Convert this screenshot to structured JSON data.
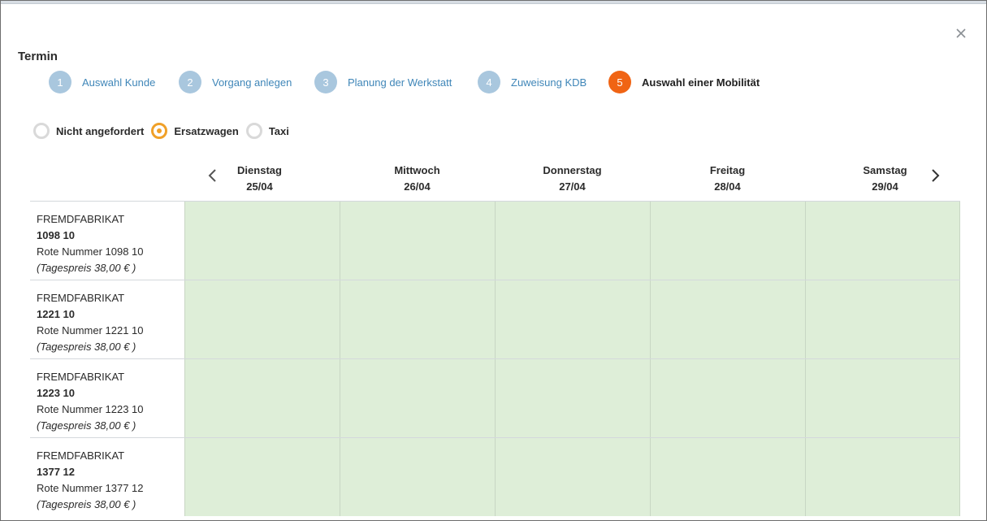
{
  "dialog": {
    "title": "Termin",
    "close_icon": "close-icon"
  },
  "steps": [
    {
      "num": "1",
      "label": "Auswahl Kunde",
      "active": false
    },
    {
      "num": "2",
      "label": "Vorgang anlegen",
      "active": false
    },
    {
      "num": "3",
      "label": "Planung der Werkstatt",
      "active": false
    },
    {
      "num": "4",
      "label": "Zuweisung KDB",
      "active": false
    },
    {
      "num": "5",
      "label": "Auswahl einer Mobilität",
      "active": true
    }
  ],
  "mobility_options": [
    {
      "label": "Nicht angefordert",
      "checked": false
    },
    {
      "label": "Ersatzwagen",
      "checked": true
    },
    {
      "label": "Taxi",
      "checked": false
    }
  ],
  "days": [
    {
      "name": "Dienstag",
      "date": "25/04"
    },
    {
      "name": "Mittwoch",
      "date": "26/04"
    },
    {
      "name": "Donnerstag",
      "date": "27/04"
    },
    {
      "name": "Freitag",
      "date": "28/04"
    },
    {
      "name": "Samstag",
      "date": "29/04"
    }
  ],
  "vehicles": [
    {
      "make": "FREMDFABRIKAT",
      "plate": "1098 10",
      "red_number": "Rote Nummer 1098 10",
      "price": "(Tagespreis 38,00 € )"
    },
    {
      "make": "FREMDFABRIKAT",
      "plate": "1221 10",
      "red_number": "Rote Nummer 1221 10",
      "price": "(Tagespreis 38,00 € )"
    },
    {
      "make": "FREMDFABRIKAT",
      "plate": "1223 10",
      "red_number": "Rote Nummer 1223 10",
      "price": "(Tagespreis 38,00 € )"
    },
    {
      "make": "FREMDFABRIKAT",
      "plate": "1377 12",
      "red_number": "Rote Nummer 1377 12",
      "price": "(Tagespreis 38,00 € )"
    }
  ],
  "colors": {
    "accent": "#f06414",
    "step_inactive": "#a9c7de",
    "link": "#3f86b8",
    "radio_checked": "#f0a028",
    "available_cell": "#deeed8"
  }
}
